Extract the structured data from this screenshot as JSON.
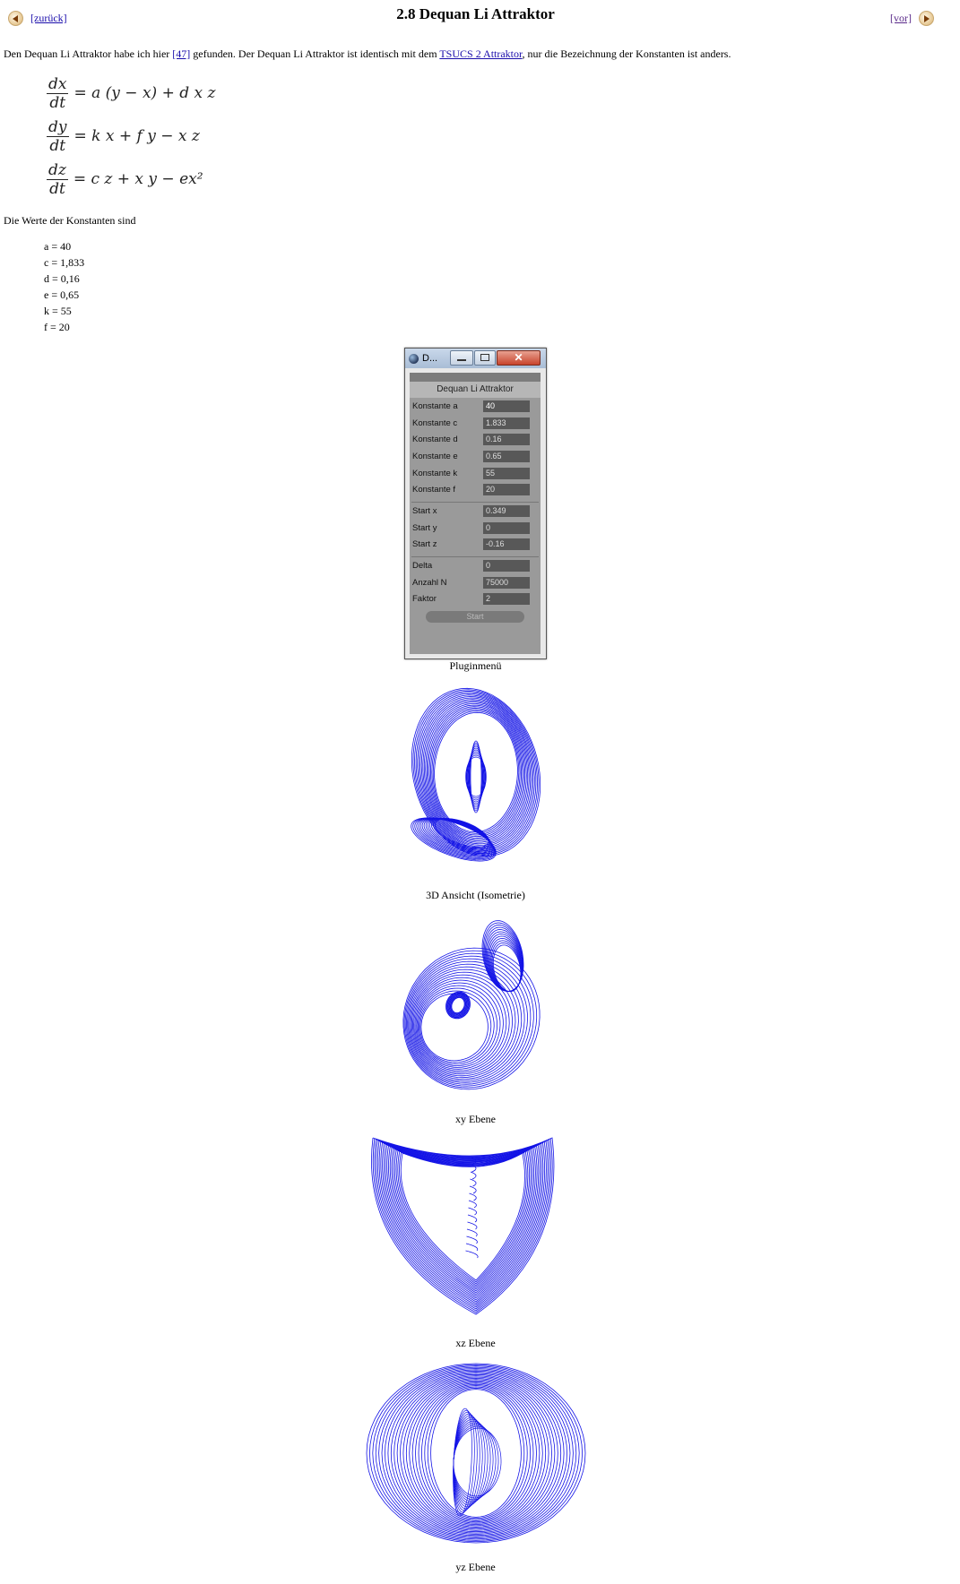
{
  "nav": {
    "back_label": "[zurück]",
    "next_label": "[vor]"
  },
  "page_title": "2.8 Dequan Li Attraktor",
  "intro": {
    "part1": "Den Dequan Li Attraktor habe ich hier ",
    "ref_link": "[47]",
    "part2": " gefunden. Der Dequan Li Attraktor ist identisch mit dem ",
    "tsucs_link": "TSUCS 2 Attraktor",
    "part3": ", nur die Bezeichnung der Konstanten ist anders."
  },
  "equations": [
    {
      "num": "dx",
      "den": "dt",
      "rhs": "=  a (y − x) + d x z"
    },
    {
      "num": "dy",
      "den": "dt",
      "rhs": "= k x + f y − x z"
    },
    {
      "num": "dz",
      "den": "dt",
      "rhs": "= c z + x y − ex²"
    }
  ],
  "values_title": "Die Werte der Konstanten sind",
  "values": [
    "a = 40",
    "c = 1,833",
    "d = 0,16",
    "e = 0,65",
    "k = 55",
    "f = 20"
  ],
  "plugin": {
    "window_title": "D...",
    "heading": "Dequan Li Attraktor",
    "group1": [
      {
        "label": "Konstante a",
        "value": "40"
      },
      {
        "label": "Konstante c",
        "value": "1.833"
      },
      {
        "label": "Konstante d",
        "value": "0.16"
      },
      {
        "label": "Konstante e",
        "value": "0.65"
      },
      {
        "label": "Konstante k",
        "value": "55"
      },
      {
        "label": "Konstante f",
        "value": "20"
      }
    ],
    "group2": [
      {
        "label": "Start x",
        "value": "0.349"
      },
      {
        "label": "Start y",
        "value": "0"
      },
      {
        "label": "Start z",
        "value": "-0.16"
      }
    ],
    "group3": [
      {
        "label": "Delta",
        "value": "0"
      },
      {
        "label": "Anzahl N",
        "value": "75000"
      },
      {
        "label": "Faktor",
        "value": "2"
      }
    ],
    "start_label": "Start",
    "caption": "Pluginmenü"
  },
  "figures": [
    {
      "caption": "3D Ansicht (Isometrie)"
    },
    {
      "caption": "xy Ebene"
    },
    {
      "caption": "xz Ebene"
    },
    {
      "caption": "yz Ebene"
    }
  ],
  "colors": {
    "trace": "#1414e6",
    "link": "#1a0dab"
  }
}
